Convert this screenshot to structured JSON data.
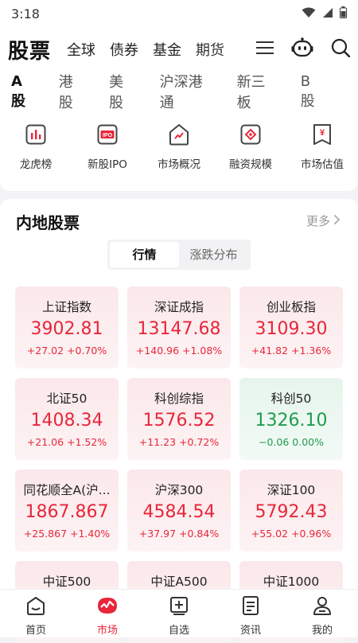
{
  "status": {
    "time": "3:18"
  },
  "header": {
    "title": "股票",
    "nav": [
      "全球",
      "债券",
      "基金",
      "期货"
    ]
  },
  "subtabs": [
    "A股",
    "港股",
    "美股",
    "沪深港通",
    "新三板",
    "B股"
  ],
  "quick": [
    {
      "label": "龙虎榜",
      "icon": "bar-chart-icon"
    },
    {
      "label": "新股IPO",
      "icon": "ipo-icon"
    },
    {
      "label": "市场概况",
      "icon": "market-house-icon"
    },
    {
      "label": "融资规模",
      "icon": "financing-icon"
    },
    {
      "label": "市场估值",
      "icon": "valuation-icon"
    }
  ],
  "section": {
    "title": "内地股票",
    "more": "更多",
    "toggle": [
      "行情",
      "涨跌分布"
    ]
  },
  "indices": [
    {
      "name": "上证指数",
      "value": "3902.81",
      "change": "+27.02 +0.70%",
      "trend": "up"
    },
    {
      "name": "深证成指",
      "value": "13147.68",
      "change": "+140.96 +1.08%",
      "trend": "up"
    },
    {
      "name": "创业板指",
      "value": "3109.30",
      "change": "+41.82 +1.36%",
      "trend": "up"
    },
    {
      "name": "北证50",
      "value": "1408.34",
      "change": "+21.06 +1.52%",
      "trend": "up"
    },
    {
      "name": "科创综指",
      "value": "1576.52",
      "change": "+11.23 +0.72%",
      "trend": "up"
    },
    {
      "name": "科创50",
      "value": "1326.10",
      "change": "−0.06 0.00%",
      "trend": "down"
    },
    {
      "name": "同花顺全A(沪...",
      "value": "1867.867",
      "change": "+25.867 +1.40%",
      "trend": "up"
    },
    {
      "name": "沪深300",
      "value": "4584.54",
      "change": "+37.97 +0.84%",
      "trend": "up"
    },
    {
      "name": "深证100",
      "value": "5792.43",
      "change": "+55.02 +0.96%",
      "trend": "up"
    },
    {
      "name": "中证500",
      "value": "",
      "change": "",
      "trend": "up"
    },
    {
      "name": "中证A500",
      "value": "",
      "change": "",
      "trend": "up"
    },
    {
      "name": "中证1000",
      "value": "",
      "change": "",
      "trend": "up"
    }
  ],
  "bottom_nav": [
    {
      "label": "首页",
      "icon": "home-icon"
    },
    {
      "label": "市场",
      "icon": "market-icon",
      "active": true
    },
    {
      "label": "自选",
      "icon": "watchlist-add-icon"
    },
    {
      "label": "资讯",
      "icon": "news-icon"
    },
    {
      "label": "我的",
      "icon": "profile-icon"
    }
  ],
  "colors": {
    "accent": "#e8263b",
    "down": "#1f9b4f"
  }
}
